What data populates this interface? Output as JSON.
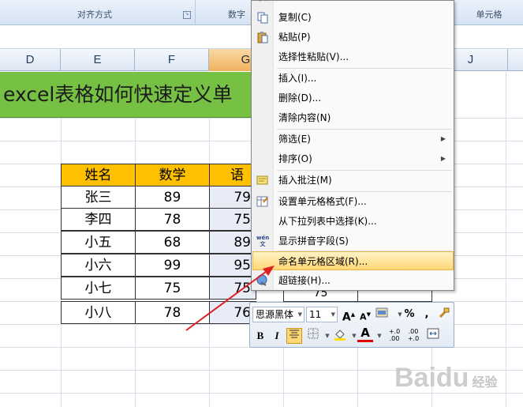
{
  "ribbon": {
    "groups": [
      "对齐方式",
      "数字",
      "单元格"
    ]
  },
  "columns": [
    "D",
    "E",
    "F",
    "G",
    "J"
  ],
  "sheet": {
    "title": "excel表格如何快速定义单"
  },
  "table": {
    "headers": [
      "姓名",
      "数学",
      "语"
    ],
    "rows": [
      [
        "张三",
        "89",
        "79"
      ],
      [
        "李四",
        "78",
        "75"
      ],
      [
        "小五",
        "68",
        "89"
      ],
      [
        "小六",
        "99",
        "95"
      ],
      [
        "小七",
        "75",
        "75"
      ],
      [
        "小八",
        "78",
        "76"
      ]
    ],
    "partial_cell": "75"
  },
  "context_menu": {
    "items": [
      {
        "label": "复制(C)",
        "icon": "copy-icon"
      },
      {
        "label": "粘贴(P)",
        "icon": "paste-icon"
      },
      {
        "label": "选择性粘贴(V)..."
      },
      {
        "label": "插入(I)..."
      },
      {
        "label": "删除(D)..."
      },
      {
        "label": "清除内容(N)"
      },
      {
        "label": "筛选(E)",
        "submenu": true
      },
      {
        "label": "排序(O)",
        "submenu": true
      },
      {
        "label": "插入批注(M)",
        "icon": "comment-icon"
      },
      {
        "label": "设置单元格格式(F)...",
        "icon": "format-cells-icon"
      },
      {
        "label": "从下拉列表中选择(K)..."
      },
      {
        "label": "显示拼音字段(S)",
        "icon": "phonetic-icon",
        "icon_text": "wén\n文"
      },
      {
        "label": "命名单元格区域(R)...",
        "highlighted": true
      },
      {
        "label": "超链接(H)...",
        "icon": "hyperlink-icon"
      }
    ]
  },
  "mini_toolbar": {
    "font_name": "思源黑体",
    "font_size": "11",
    "grow_font": "A",
    "shrink_font": "A",
    "percent": "%",
    "comma": ",",
    "bold": "B",
    "italic": "I",
    "inc_decimal": "+.0 .00",
    "dec_decimal": ".00 +.0",
    "font_color_letter": "A"
  },
  "watermark": {
    "text": "Baidu",
    "sub": "经验"
  },
  "colors": {
    "title_bg": "#76c144",
    "header_bg": "#ffc000",
    "menu_highlight": "#ffd775",
    "arrow": "#e02020"
  }
}
